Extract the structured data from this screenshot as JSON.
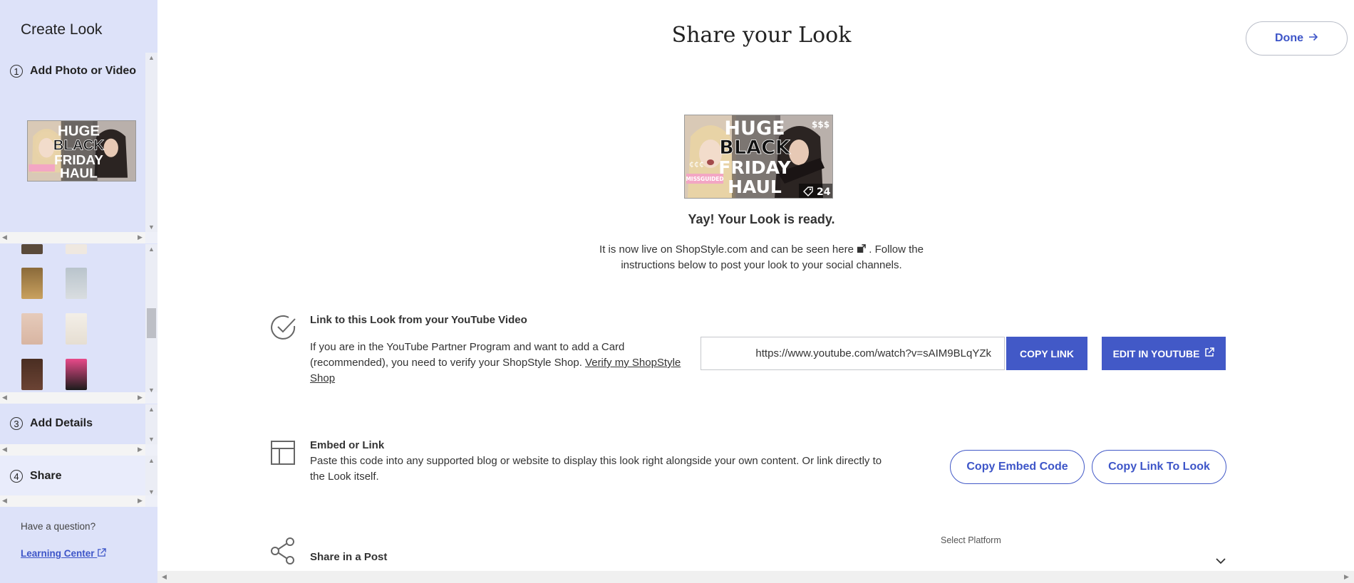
{
  "sidebar": {
    "title": "Create Look",
    "steps": [
      {
        "num": "1",
        "label": "Add Photo or Video"
      },
      {
        "num": "3",
        "label": "Add Details"
      },
      {
        "num": "4",
        "label": "Share"
      }
    ],
    "question": "Have a question?",
    "learning_center": "Learning Center"
  },
  "header": {
    "title": "Share your Look",
    "done_label": "Done"
  },
  "thumbnail": {
    "words": [
      "HUGE",
      "BLACK",
      "FRIDAY",
      "HAUL"
    ],
    "dollars": "$$$",
    "cents": "¢¢¢",
    "brand": "MISSGUIDED",
    "product_count": "24"
  },
  "ready": {
    "title": "Yay! Your Look is ready.",
    "desc_part1": "It is now live on ShopStyle.com and can be seen here",
    "desc_part2": ". Follow the instructions below to post your look to your social channels."
  },
  "youtube_section": {
    "title": "Link to this Look from your YouTube Video",
    "desc": "If you are in the YouTube Partner Program and want to add a Card (recommended), you need to verify your ShopStyle Shop.",
    "verify_link": "Verify my ShopStyle Shop",
    "url": "https://www.youtube.com/watch?v=sAIM9BLqYZk",
    "copy_link": "COPY LINK",
    "edit_youtube": "EDIT IN YOUTUBE"
  },
  "embed_section": {
    "title": "Embed or Link",
    "desc": "Paste this code into any supported blog or website to display this look right alongside your own content. Or link directly to the Look itself.",
    "copy_embed": "Copy Embed Code",
    "copy_link_look": "Copy Link To Look"
  },
  "share_section": {
    "title": "Share in a Post",
    "select_label": "Select Platform"
  },
  "colors": {
    "accent": "#4259c7",
    "sidebar_bg": "#dde2f9"
  }
}
